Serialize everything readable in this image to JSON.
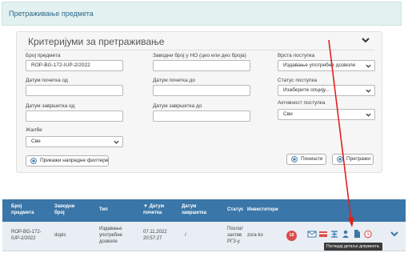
{
  "header": {
    "title": "Претраживање предмета"
  },
  "criteria": {
    "title": "Критеријуми за претраживање",
    "case_number": {
      "label": "Број предмета",
      "value": "ROP-BG-172-IUP-2/2022"
    },
    "incoming_number": {
      "label": "Заводни број у НО (цео или део броја)",
      "value": ""
    },
    "procedure_type": {
      "label": "Врста поступка",
      "value": "Издавање употребне дозволе"
    },
    "start_date_from": {
      "label": "Датум почетка од",
      "value": ""
    },
    "start_date_to": {
      "label": "Датум почетка до",
      "value": ""
    },
    "procedure_status": {
      "label": "Статус поступка",
      "value": "Изаберите опцију..."
    },
    "end_date_from": {
      "label": "Датум завршетка од",
      "value": ""
    },
    "end_date_to": {
      "label": "Датум завршетка до",
      "value": ""
    },
    "procedure_activity": {
      "label": "Активност поступка",
      "value": "Сви"
    },
    "complaints": {
      "label": "Жалбе",
      "value": "Све"
    },
    "advanced_button": "Прикажи напредне филтере",
    "reset_button": "Поништи",
    "search_button": "Претражи"
  },
  "table": {
    "columns": [
      "Број предмета",
      "Заводни број",
      "Тип",
      "▼ Датум почетка",
      "Датум завршетка",
      "Статус",
      "Инвеститори"
    ],
    "row": {
      "case_number": "ROP-BG-172-IUP-2/2022",
      "incoming_number": "dopis",
      "type": "Издавање употребне дозволе",
      "start_date": "07.11.2022 20:57:27",
      "end_date": "/",
      "status": "Послат захтев РГЗ-у",
      "investors": "zora ko",
      "badge": "19"
    },
    "tooltip": "Погледај детаље документа."
  },
  "colors": {
    "accent": "#3a76a8",
    "topbar": "#e3f1f0",
    "badge": "#d94c4c",
    "annotation_arrow": "#e02020"
  },
  "icons": [
    "chevron-down-icon",
    "envelope-icon",
    "card-icon",
    "hierarchy-icon",
    "person-icon",
    "document-icon",
    "clock-icon"
  ]
}
